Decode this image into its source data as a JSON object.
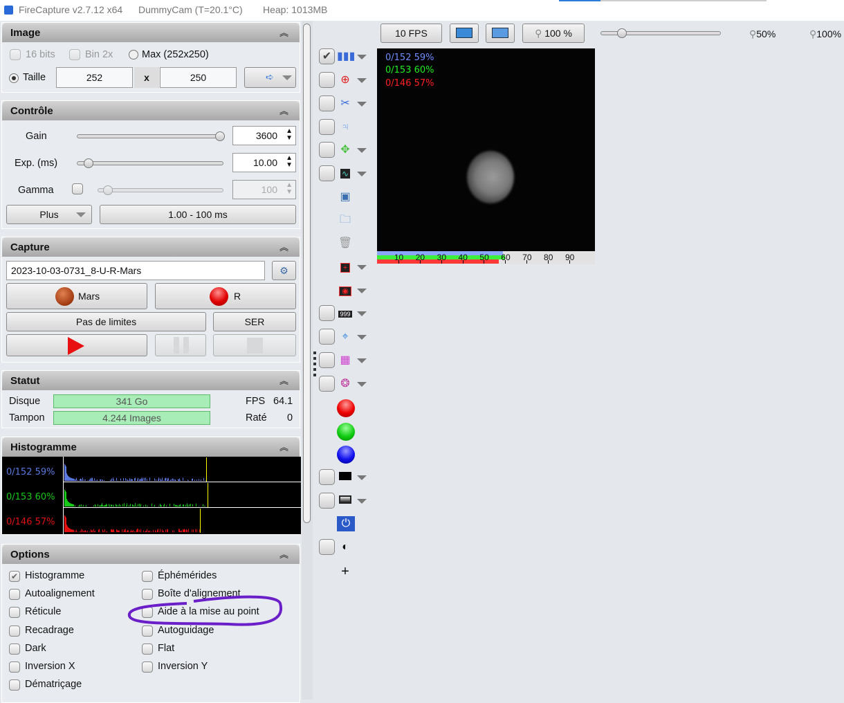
{
  "titlebar": {
    "app": "FireCapture v2.7.12 x64",
    "camera": "DummyCam (T=20.1°C)",
    "heap": "Heap: 1013MB"
  },
  "image_panel": {
    "title": "Image",
    "bits16": "16 bits",
    "bin2x": "Bin 2x",
    "max": "Max (252x250)",
    "taille": "Taille",
    "width": "252",
    "x": "x",
    "height": "250",
    "selected_mode": "Taille"
  },
  "controle": {
    "title": "Contrôle",
    "gain_label": "Gain",
    "gain_value": "3600",
    "gain_level": 1.0,
    "exp_label": "Exp. (ms)",
    "exp_value": "10.00",
    "exp_level": 0.05,
    "gamma_label": "Gamma",
    "gamma_value": "100",
    "gamma_level": 0.05,
    "plus": "Plus",
    "range": "1.00 - 100 ms"
  },
  "capture": {
    "title": "Capture",
    "filename": "2023-10-03-0731_8-U-R-Mars",
    "object": "Mars",
    "filter": "R",
    "limit": "Pas de limites",
    "format": "SER"
  },
  "statut": {
    "title": "Statut",
    "disque_label": "Disque",
    "disque_value": "341 Go",
    "tampon_label": "Tampon",
    "tampon_value": "4.244 Images",
    "fps_label": "FPS",
    "fps_value": "64.1",
    "rate_label": "Raté",
    "rate_value": "0"
  },
  "histogramme": {
    "title": "Histogramme",
    "channels": [
      {
        "label": "0/152 59%",
        "color": "#5a78e0"
      },
      {
        "label": "0/153 60%",
        "color": "#18c818"
      },
      {
        "label": "0/146 57%",
        "color": "#e01010"
      }
    ]
  },
  "options": {
    "title": "Options",
    "items": [
      {
        "label": "Histogramme",
        "checked": true
      },
      {
        "label": "Éphémérides",
        "checked": false
      },
      {
        "label": "Autoalignement",
        "checked": false
      },
      {
        "label": "Boîte d'alignement",
        "checked": false
      },
      {
        "label": "Réticule",
        "checked": false
      },
      {
        "label": "Aide à la mise au point",
        "checked": false
      },
      {
        "label": "Recadrage",
        "checked": false
      },
      {
        "label": "Autoguidage",
        "checked": false
      },
      {
        "label": "Dark",
        "checked": false
      },
      {
        "label": "Flat",
        "checked": false
      },
      {
        "label": "Inversion X",
        "checked": false
      },
      {
        "label": "Inversion Y",
        "checked": false
      },
      {
        "label": "Dématriçage",
        "checked": false
      }
    ]
  },
  "toolbar": {
    "fps": "10 FPS",
    "zoom": "100 %",
    "zoom50": "50%",
    "zoom100": "100%",
    "zoom_slider_level": 0.15
  },
  "overlay": [
    {
      "text": "0/152 59%",
      "color": "#6f8cff"
    },
    {
      "text": "0/153 60%",
      "color": "#22ee22"
    },
    {
      "text": "0/146 57%",
      "color": "#ff2020"
    }
  ],
  "ruler": {
    "ticks": [
      "10",
      "20",
      "30",
      "40",
      "50",
      "60",
      "70",
      "80",
      "90"
    ],
    "blue_pct": 59,
    "green_pct": 60,
    "red_pct": 57
  },
  "annotation_color": "#6a1fc8"
}
